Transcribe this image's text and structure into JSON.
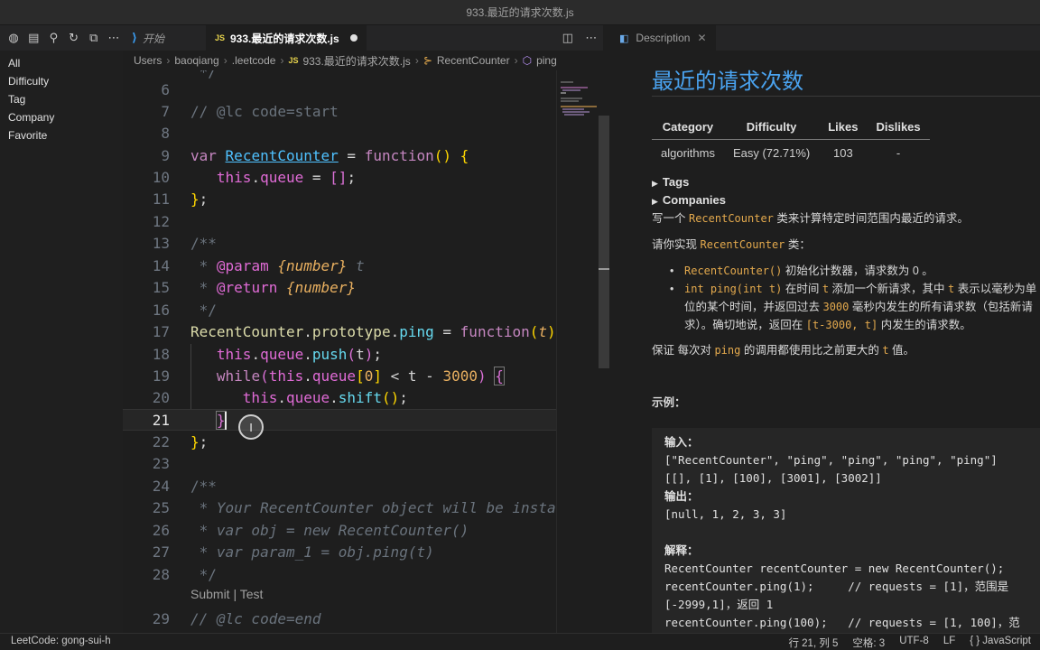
{
  "window": {
    "title": "933.最近的请求次数.js"
  },
  "toolbar": {
    "icons": [
      "globe-icon",
      "explorer-icon",
      "search-icon",
      "refresh-icon",
      "collapse-icon",
      "more-icon"
    ]
  },
  "tabs": [
    {
      "label": "开始",
      "active": false
    },
    {
      "label": "933.最近的请求次数.js",
      "active": true,
      "dirty": true
    }
  ],
  "sidebar": {
    "items": [
      "All",
      "Difficulty",
      "Tag",
      "Company",
      "Favorite"
    ]
  },
  "breadcrumb": [
    "Users",
    "baoqiang",
    ".leetcode",
    "933.最近的请求次数.js",
    "RecentCounter",
    "ping"
  ],
  "editor": {
    "line_numbers": [
      "6",
      "7",
      "8",
      "9",
      "10",
      "11",
      "12",
      "13",
      "14",
      "15",
      "16",
      "17",
      "18",
      "19",
      "20",
      "21",
      "22",
      "23",
      "24",
      "25",
      "26",
      "27",
      "28",
      "29"
    ],
    "current_line": "21",
    "codelens": "Submit | Test"
  },
  "description": {
    "tab_label": "Description",
    "title": "最近的请求次数",
    "table": {
      "headers": [
        "Category",
        "Difficulty",
        "Likes",
        "Dislikes"
      ],
      "row": [
        "algorithms",
        "Easy (72.71%)",
        "103",
        "-"
      ]
    },
    "tags_label": "Tags",
    "companies_label": "Companies",
    "intro_pre": "写一个 ",
    "intro_code": "RecentCounter",
    "intro_post": " 类来计算特定时间范围内最近的请求。",
    "impl_pre": "请你实现 ",
    "impl_code": "RecentCounter",
    "impl_post": " 类：",
    "b1_code": "RecentCounter()",
    "b1_text": " 初始化计数器，请求数为 0 。",
    "b2_code": "int ping(int t)",
    "b2_text1": " 在时间 ",
    "b2_t": "t",
    "b2_text2": " 添加一个新请求，其中 ",
    "b2_t2": "t",
    "b2_text3": " 表示以毫秒为单",
    "b2_line2_pre": "位的某个时间，并返回过去 ",
    "b2_line2_code": "3000",
    "b2_line2_post": " 毫秒内发生的所有请求数（包括新请",
    "b2_line3_pre": "求）。确切地说，返回在 ",
    "b2_line3_code": "[t-3000, t]",
    "b2_line3_post": " 内发生的请求数。",
    "guarantee_pre": "保证 每次对 ",
    "guarantee_code": "ping",
    "guarantee_mid": " 的调用都使用比之前更大的 ",
    "guarantee_t": "t",
    "guarantee_post": " 值。",
    "example_label": "示例：",
    "example_lines": [
      "输入：",
      "[\"RecentCounter\", \"ping\", \"ping\", \"ping\", \"ping\"]",
      "[[], [1], [100], [3001], [3002]]",
      "输出：",
      "[null, 1, 2, 3, 3]",
      "",
      "解释：",
      "RecentCounter recentCounter = new RecentCounter();",
      "recentCounter.ping(1);     // requests = [1]，范围是",
      "[-2999,1]，返回 1",
      "recentCounter.ping(100);   // requests = [1, 100]，范"
    ]
  },
  "statusbar": {
    "left": "LeetCode: gong-sui-h",
    "position": "行 21, 列 5",
    "indent": "空格: 3",
    "encoding": "UTF-8",
    "eol": "LF",
    "language": "{ } JavaScript"
  }
}
